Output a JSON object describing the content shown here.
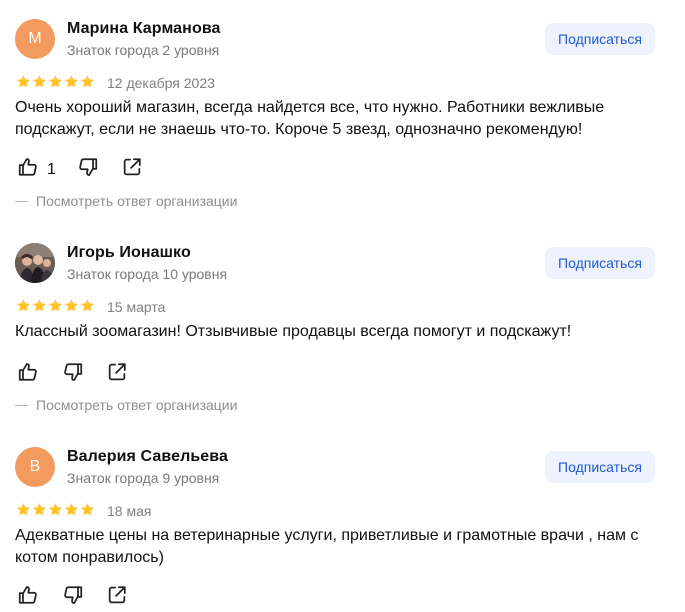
{
  "reviews": [
    {
      "author": "Марина Карманова",
      "avatar_letter": "М",
      "level": "Знаток города 2 уровня",
      "subscribe_label": "Подписаться",
      "rating": 5,
      "date": "12 декабря 2023",
      "text": "Очень хороший магазин, всегда найдется все, что нужно. Работники вежливые подскажут, если не знаешь что-то. Короче 5 звезд, однозначно рекомендую!",
      "likes": "1",
      "org_reply_label": "Посмотреть ответ организации"
    },
    {
      "author": "Игорь Ионашко",
      "avatar_letter": "",
      "level": "Знаток города 10 уровня",
      "subscribe_label": "Подписаться",
      "rating": 5,
      "date": "15 марта",
      "text": "Классный зоомагазин! Отзывчивые продавцы всегда помогут и подскажут!",
      "likes": "",
      "org_reply_label": "Посмотреть ответ организации"
    },
    {
      "author": "Валерия Савельева",
      "avatar_letter": "В",
      "level": "Знаток города 9 уровня",
      "subscribe_label": "Подписаться",
      "rating": 5,
      "date": "18 мая",
      "text": "Адекватные цены на ветеринарные услуги, приветливые и грамотные врачи , нам с котом понравилось)",
      "likes": ""
    }
  ],
  "colors": {
    "star": "#fcc32c",
    "avatar_bg": "#f39a5e",
    "subscribe_bg": "#edf2fd",
    "subscribe_text": "#1f5ad6",
    "muted_text": "#808080"
  },
  "icons": [
    "star-icon",
    "thumbs-up-icon",
    "thumbs-down-icon",
    "share-icon",
    "avatar-photo"
  ]
}
